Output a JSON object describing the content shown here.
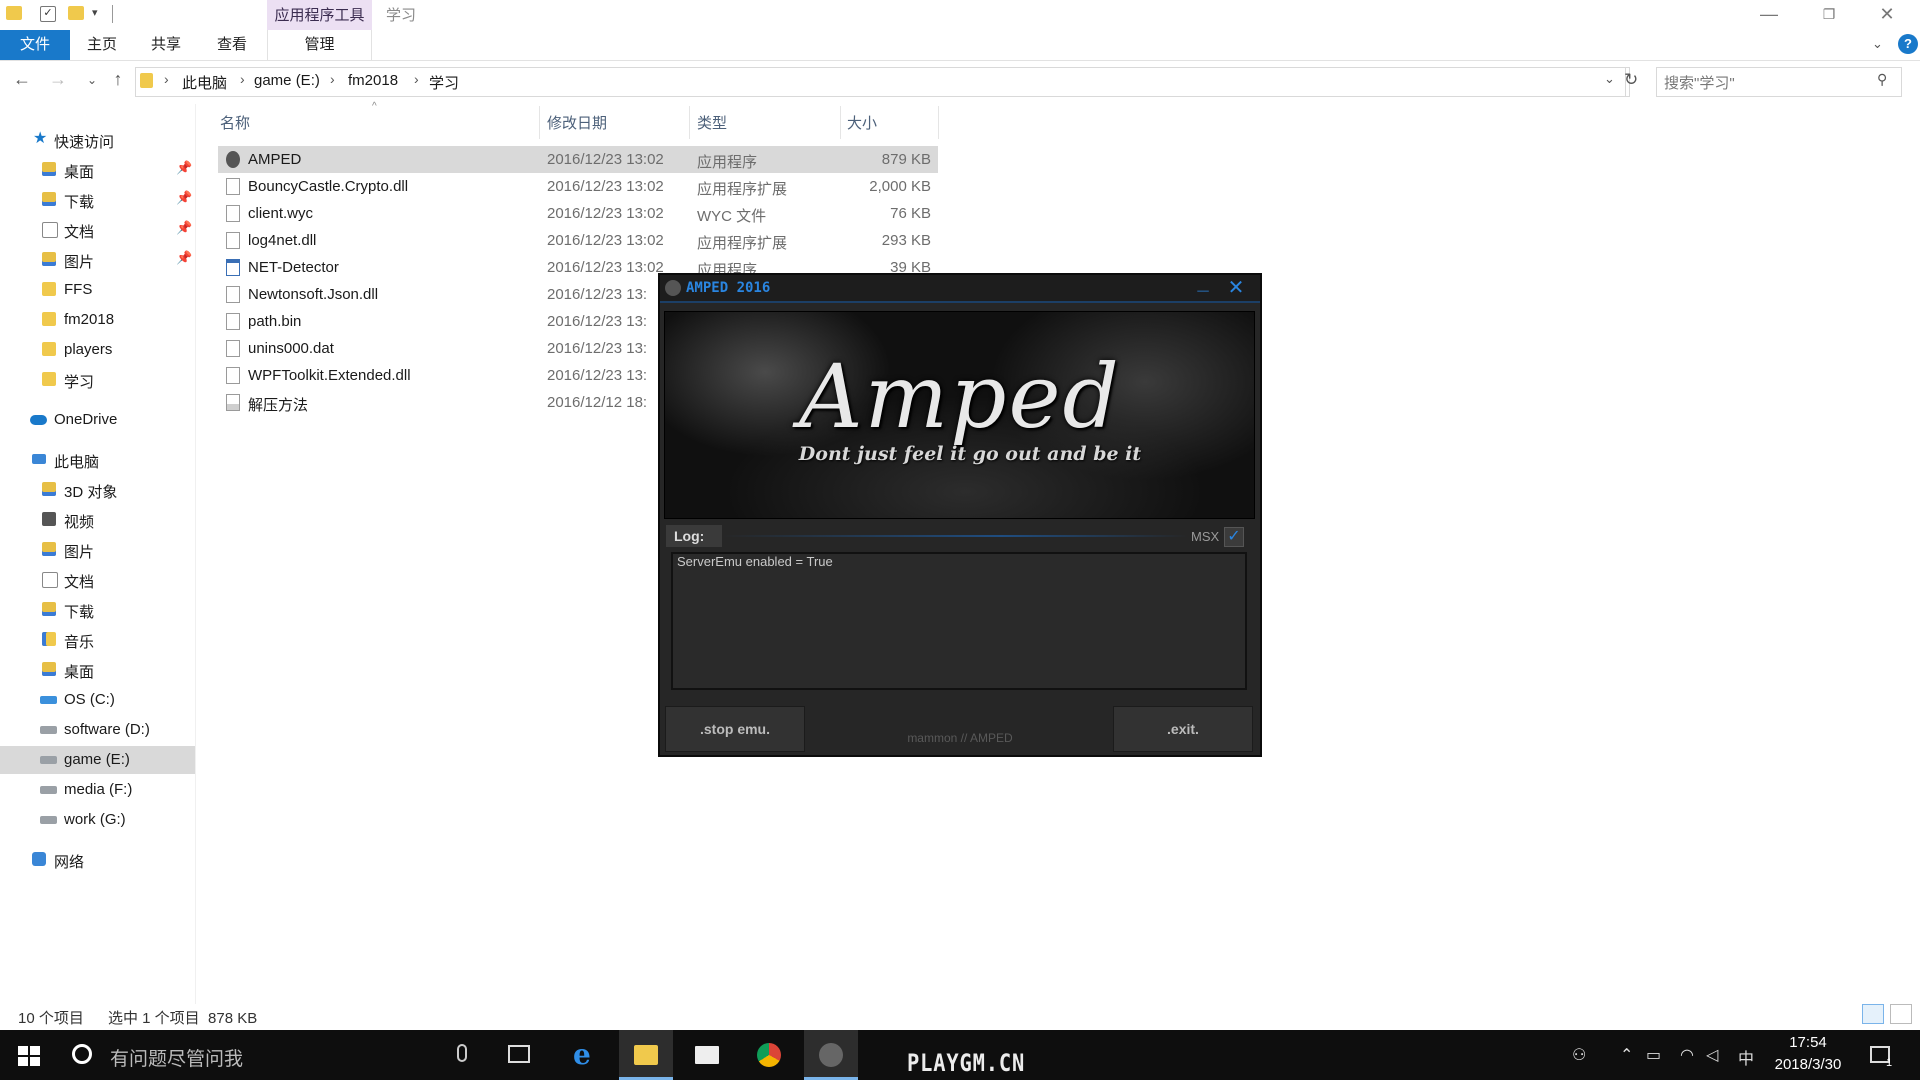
{
  "ribbon": {
    "context_group": "应用程序工具",
    "window_title": "学习",
    "tabs": [
      "文件",
      "主页",
      "共享",
      "查看",
      "管理"
    ]
  },
  "address": {
    "crumbs": [
      "此电脑",
      "game (E:)",
      "fm2018",
      "学习"
    ],
    "search_placeholder": "搜索\"学习\""
  },
  "nav": {
    "quick_access": "快速访问",
    "quick_items": [
      "桌面",
      "下载",
      "文档",
      "图片",
      "FFS",
      "fm2018",
      "players",
      "学习"
    ],
    "onedrive": "OneDrive",
    "this_pc": "此电脑",
    "pc_items": [
      "3D 对象",
      "视频",
      "图片",
      "文档",
      "下载",
      "音乐",
      "桌面",
      "OS (C:)",
      "software (D:)",
      "game (E:)",
      "media (F:)",
      "work (G:)"
    ],
    "network": "网络"
  },
  "list": {
    "headers": [
      "名称",
      "修改日期",
      "类型",
      "大小"
    ],
    "files": [
      {
        "name": "AMPED",
        "date": "2016/12/23 13:02",
        "type": "应用程序",
        "size": "879 KB"
      },
      {
        "name": "BouncyCastle.Crypto.dll",
        "date": "2016/12/23 13:02",
        "type": "应用程序扩展",
        "size": "2,000 KB"
      },
      {
        "name": "client.wyc",
        "date": "2016/12/23 13:02",
        "type": "WYC 文件",
        "size": "76 KB"
      },
      {
        "name": "log4net.dll",
        "date": "2016/12/23 13:02",
        "type": "应用程序扩展",
        "size": "293 KB"
      },
      {
        "name": "NET-Detector",
        "date": "2016/12/23 13:02",
        "type": "应用程序",
        "size": "39 KB"
      },
      {
        "name": "Newtonsoft.Json.dll",
        "date": "2016/12/23 13:",
        "type": "",
        "size": ""
      },
      {
        "name": "path.bin",
        "date": "2016/12/23 13:",
        "type": "",
        "size": ""
      },
      {
        "name": "unins000.dat",
        "date": "2016/12/23 13:",
        "type": "",
        "size": ""
      },
      {
        "name": "WPFToolkit.Extended.dll",
        "date": "2016/12/23 13:",
        "type": "",
        "size": ""
      },
      {
        "name": "解压方法",
        "date": "2016/12/12 18:",
        "type": "",
        "size": ""
      }
    ]
  },
  "status": {
    "count": "10 个项目",
    "selection": "选中 1 个项目  878 KB"
  },
  "amped": {
    "title": "AMPED 2016",
    "logo": "Amped",
    "tagline": "Dont just feel it   go out and be it",
    "log_label": "Log:",
    "msx_label": "MSX",
    "log_text": "ServerEmu enabled = True",
    "stop_button": ".stop emu.",
    "exit_button": ".exit.",
    "credit": "mammon // AMPED"
  },
  "taskbar": {
    "search_placeholder": "有问题尽管问我",
    "watermark": "PLAYGM.CN",
    "ime": "中",
    "time": "17:54",
    "date": "2018/3/30",
    "notification_count": "1"
  }
}
